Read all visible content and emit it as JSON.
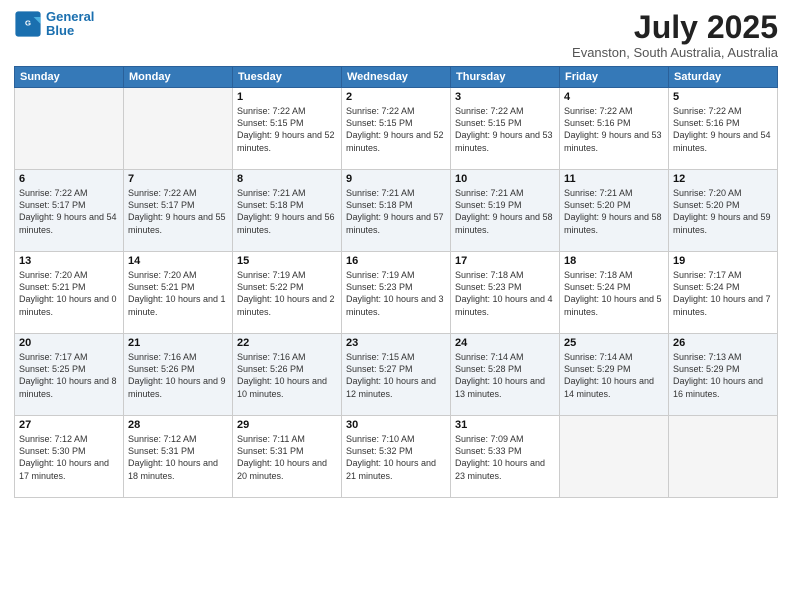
{
  "logo": {
    "line1": "General",
    "line2": "Blue"
  },
  "title": "July 2025",
  "subtitle": "Evanston, South Australia, Australia",
  "days_of_week": [
    "Sunday",
    "Monday",
    "Tuesday",
    "Wednesday",
    "Thursday",
    "Friday",
    "Saturday"
  ],
  "weeks": [
    [
      {
        "day": "",
        "info": ""
      },
      {
        "day": "",
        "info": ""
      },
      {
        "day": "1",
        "info": "Sunrise: 7:22 AM\nSunset: 5:15 PM\nDaylight: 9 hours and 52 minutes."
      },
      {
        "day": "2",
        "info": "Sunrise: 7:22 AM\nSunset: 5:15 PM\nDaylight: 9 hours and 52 minutes."
      },
      {
        "day": "3",
        "info": "Sunrise: 7:22 AM\nSunset: 5:15 PM\nDaylight: 9 hours and 53 minutes."
      },
      {
        "day": "4",
        "info": "Sunrise: 7:22 AM\nSunset: 5:16 PM\nDaylight: 9 hours and 53 minutes."
      },
      {
        "day": "5",
        "info": "Sunrise: 7:22 AM\nSunset: 5:16 PM\nDaylight: 9 hours and 54 minutes."
      }
    ],
    [
      {
        "day": "6",
        "info": "Sunrise: 7:22 AM\nSunset: 5:17 PM\nDaylight: 9 hours and 54 minutes."
      },
      {
        "day": "7",
        "info": "Sunrise: 7:22 AM\nSunset: 5:17 PM\nDaylight: 9 hours and 55 minutes."
      },
      {
        "day": "8",
        "info": "Sunrise: 7:21 AM\nSunset: 5:18 PM\nDaylight: 9 hours and 56 minutes."
      },
      {
        "day": "9",
        "info": "Sunrise: 7:21 AM\nSunset: 5:18 PM\nDaylight: 9 hours and 57 minutes."
      },
      {
        "day": "10",
        "info": "Sunrise: 7:21 AM\nSunset: 5:19 PM\nDaylight: 9 hours and 58 minutes."
      },
      {
        "day": "11",
        "info": "Sunrise: 7:21 AM\nSunset: 5:20 PM\nDaylight: 9 hours and 58 minutes."
      },
      {
        "day": "12",
        "info": "Sunrise: 7:20 AM\nSunset: 5:20 PM\nDaylight: 9 hours and 59 minutes."
      }
    ],
    [
      {
        "day": "13",
        "info": "Sunrise: 7:20 AM\nSunset: 5:21 PM\nDaylight: 10 hours and 0 minutes."
      },
      {
        "day": "14",
        "info": "Sunrise: 7:20 AM\nSunset: 5:21 PM\nDaylight: 10 hours and 1 minute."
      },
      {
        "day": "15",
        "info": "Sunrise: 7:19 AM\nSunset: 5:22 PM\nDaylight: 10 hours and 2 minutes."
      },
      {
        "day": "16",
        "info": "Sunrise: 7:19 AM\nSunset: 5:23 PM\nDaylight: 10 hours and 3 minutes."
      },
      {
        "day": "17",
        "info": "Sunrise: 7:18 AM\nSunset: 5:23 PM\nDaylight: 10 hours and 4 minutes."
      },
      {
        "day": "18",
        "info": "Sunrise: 7:18 AM\nSunset: 5:24 PM\nDaylight: 10 hours and 5 minutes."
      },
      {
        "day": "19",
        "info": "Sunrise: 7:17 AM\nSunset: 5:24 PM\nDaylight: 10 hours and 7 minutes."
      }
    ],
    [
      {
        "day": "20",
        "info": "Sunrise: 7:17 AM\nSunset: 5:25 PM\nDaylight: 10 hours and 8 minutes."
      },
      {
        "day": "21",
        "info": "Sunrise: 7:16 AM\nSunset: 5:26 PM\nDaylight: 10 hours and 9 minutes."
      },
      {
        "day": "22",
        "info": "Sunrise: 7:16 AM\nSunset: 5:26 PM\nDaylight: 10 hours and 10 minutes."
      },
      {
        "day": "23",
        "info": "Sunrise: 7:15 AM\nSunset: 5:27 PM\nDaylight: 10 hours and 12 minutes."
      },
      {
        "day": "24",
        "info": "Sunrise: 7:14 AM\nSunset: 5:28 PM\nDaylight: 10 hours and 13 minutes."
      },
      {
        "day": "25",
        "info": "Sunrise: 7:14 AM\nSunset: 5:29 PM\nDaylight: 10 hours and 14 minutes."
      },
      {
        "day": "26",
        "info": "Sunrise: 7:13 AM\nSunset: 5:29 PM\nDaylight: 10 hours and 16 minutes."
      }
    ],
    [
      {
        "day": "27",
        "info": "Sunrise: 7:12 AM\nSunset: 5:30 PM\nDaylight: 10 hours and 17 minutes."
      },
      {
        "day": "28",
        "info": "Sunrise: 7:12 AM\nSunset: 5:31 PM\nDaylight: 10 hours and 18 minutes."
      },
      {
        "day": "29",
        "info": "Sunrise: 7:11 AM\nSunset: 5:31 PM\nDaylight: 10 hours and 20 minutes."
      },
      {
        "day": "30",
        "info": "Sunrise: 7:10 AM\nSunset: 5:32 PM\nDaylight: 10 hours and 21 minutes."
      },
      {
        "day": "31",
        "info": "Sunrise: 7:09 AM\nSunset: 5:33 PM\nDaylight: 10 hours and 23 minutes."
      },
      {
        "day": "",
        "info": ""
      },
      {
        "day": "",
        "info": ""
      }
    ]
  ]
}
